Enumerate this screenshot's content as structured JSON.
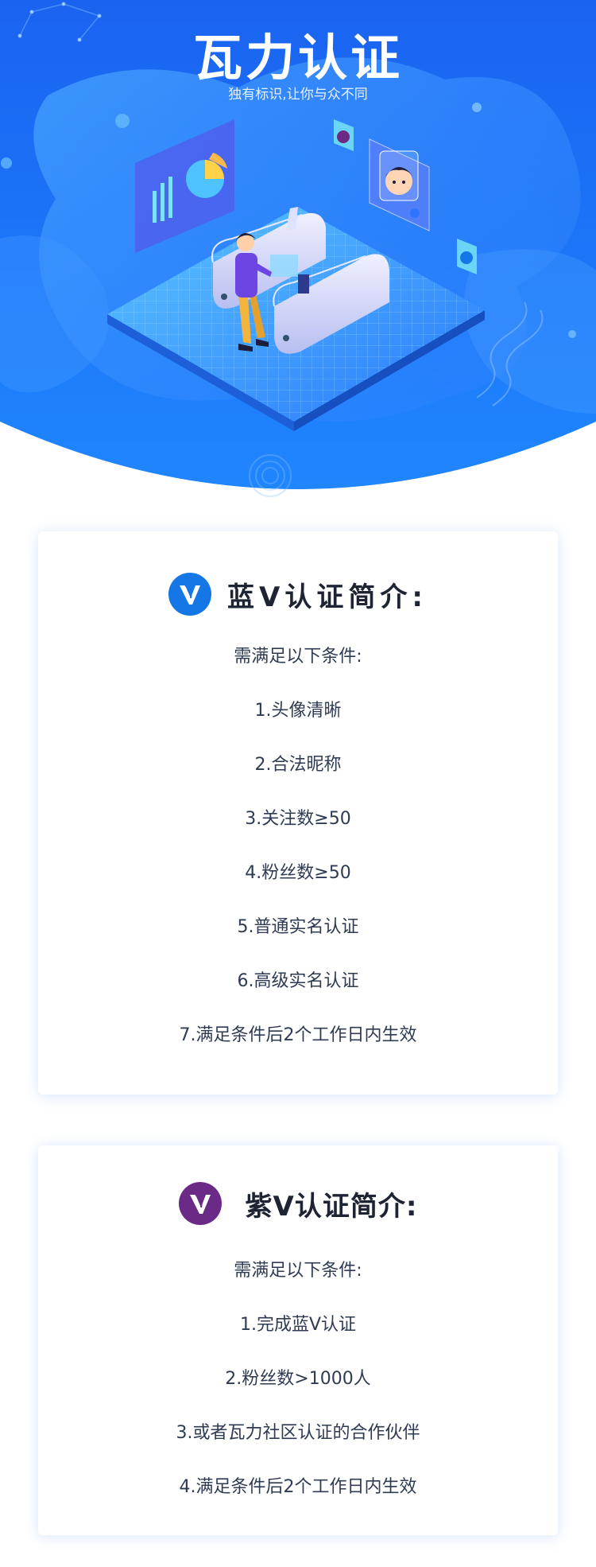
{
  "hero": {
    "title": "瓦力认证",
    "subtitle": "独有标识,让你与众不同"
  },
  "colors": {
    "hero_blue": "#1a6ff0",
    "hero_light": "#3d9bff",
    "blue_badge": "#1577e6",
    "purple_badge": "#6b2a86",
    "text_dark": "#1e2433",
    "text_body": "#2f3b52"
  },
  "blue_v": {
    "icon": "blue-v-badge-icon",
    "title": "蓝V认证简介:",
    "intro": "需满足以下条件:",
    "requirements": [
      "1.头像清晰",
      "2.合法昵称",
      "3.关注数≥50",
      "4.粉丝数≥50",
      "5.普通实名认证",
      "6.高级实名认证",
      "7.满足条件后2个工作日内生效"
    ]
  },
  "purple_v": {
    "icon": "purple-v-badge-icon",
    "title": "紫V认证简介:",
    "intro": "需满足以下条件:",
    "requirements": [
      "1.完成蓝V认证",
      "2.粉丝数>1000人",
      "3.或者瓦力社区认证的合作伙伴",
      "4.满足条件后2个工作日内生效"
    ]
  }
}
